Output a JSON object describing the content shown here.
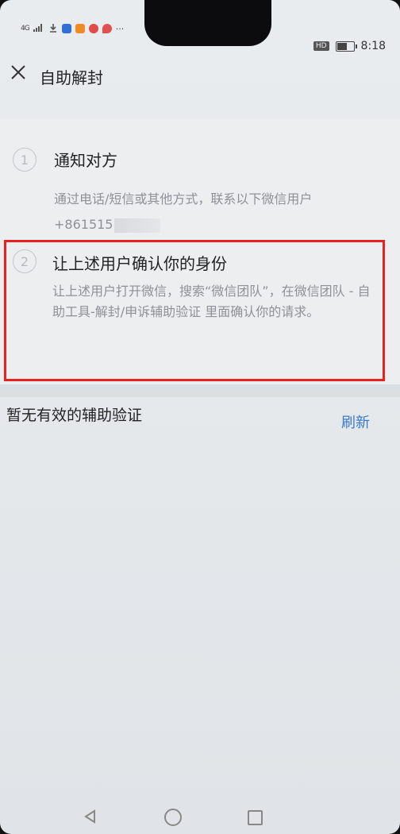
{
  "status_bar": {
    "network": "4G",
    "time": "8:18",
    "hd": "HD",
    "battery_level": 0.55
  },
  "header": {
    "title": "自助解封"
  },
  "steps": [
    {
      "number": "1",
      "title": "通知对方",
      "desc_line1": "通过电话/短信或其他方式，联系以下微信用户",
      "desc_line2": "+861515"
    },
    {
      "number": "2",
      "title": "让上述用户确认你的身份",
      "desc": "让上述用户打开微信，搜索“微信团队”，在微信团队 - 自助工具-解封/申诉辅助验证 里面确认你的请求。"
    }
  ],
  "verification": {
    "status": "暂无有效的辅助验证",
    "refresh_label": "刷新"
  },
  "colors": {
    "accent_blue": "#3a78c9",
    "highlight_red": "#e8231f"
  }
}
